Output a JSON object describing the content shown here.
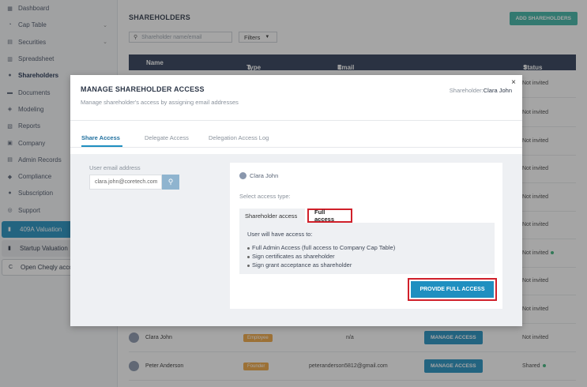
{
  "sidebar": {
    "items": [
      {
        "label": "Dashboard",
        "icon": "grid-icon"
      },
      {
        "label": "Cap Table",
        "icon": "pie-icon",
        "expandable": true
      },
      {
        "label": "Securities",
        "icon": "certificate-icon",
        "expandable": true
      },
      {
        "label": "Spreadsheet",
        "icon": "table-icon"
      },
      {
        "label": "Shareholders",
        "icon": "people-icon",
        "active": true
      },
      {
        "label": "Documents",
        "icon": "folder-icon"
      },
      {
        "label": "Modeling",
        "icon": "model-icon"
      },
      {
        "label": "Reports",
        "icon": "report-icon"
      },
      {
        "label": "Company",
        "icon": "building-icon"
      },
      {
        "label": "Admin Records",
        "icon": "records-icon"
      },
      {
        "label": "Compliance",
        "icon": "shield-icon"
      },
      {
        "label": "Subscription",
        "icon": "info-icon"
      },
      {
        "label": "Support",
        "icon": "support-icon"
      }
    ],
    "valuation_409a": "409A Valuation",
    "startup_valuation": "Startup Valuation",
    "open_cheqly": "Open Cheqly account"
  },
  "main": {
    "title": "SHAREHOLDERS",
    "add_button": "ADD SHAREHOLDERS",
    "search_placeholder": "Shareholder name/email",
    "filters_label": "Filters",
    "columns": {
      "name": "Name",
      "type": "Type",
      "email": "Email",
      "status": "Status"
    },
    "bg_statuses": [
      "Not invited",
      "Not invited",
      "Not invited",
      "Not invited",
      "Not invited",
      "Not invited",
      "Not invited",
      "Not invited",
      "Not invited"
    ],
    "rows": [
      {
        "name": "Clara John",
        "type": "Employee",
        "email": "n/a",
        "manage": "MANAGE ACCESS",
        "status": "Not invited"
      },
      {
        "name": "Peter Anderson",
        "type": "Founder",
        "email": "peteranderson5812@gmail.com",
        "manage": "MANAGE ACCESS",
        "status": "Shared"
      }
    ]
  },
  "modal": {
    "title": "MANAGE SHAREHOLDER ACCESS",
    "subtitle": "Manage shareholder's access by assigning email addresses",
    "shareholder_prefix": "Shareholder:",
    "shareholder_name": "Clara John",
    "close_glyph": "×",
    "tabs": [
      "Share Access",
      "Delegate Access",
      "Delegation Access Log"
    ],
    "email_label": "User email address",
    "email_value": "clara.john@coretech.com",
    "card_user": "Clara John",
    "select_label": "Select access type:",
    "access_types": [
      "Shareholder access",
      "Full access"
    ],
    "access_intro": "User will have access to:",
    "access_items": [
      "Full Admin Access (full access to Company Cap Table)",
      "Sign certificates as shareholder",
      "Sign grant acceptance as shareholder"
    ],
    "provide_button": "PROVIDE FULL ACCESS"
  },
  "colors": {
    "primary": "#1f8fc0",
    "header": "#2b3a55",
    "highlight": "#d0202a",
    "teal": "#3cb4a4"
  }
}
